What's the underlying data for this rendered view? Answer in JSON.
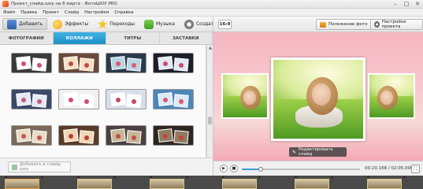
{
  "window": {
    "title": "Проект_слайд-шоу на 8 марта - ФотоШОУ PRO",
    "controls": [
      "–",
      "□",
      "✕"
    ]
  },
  "menu": [
    "Файл",
    "Правка",
    "Проект",
    "Слайд",
    "Настройки",
    "Справка"
  ],
  "toolbar": {
    "add_label": "Добавить",
    "effects_label": "Эффекты",
    "transitions_label": "Переходы",
    "music_label": "Музыка",
    "create_label": "Создать"
  },
  "tabs": [
    "ФОТОГРАФИИ",
    "КОЛЛАЖИ",
    "ТИТРЫ",
    "ЗАСТАВКИ"
  ],
  "active_tab": "КОЛЛАЖИ",
  "collages": [
    {
      "palette": [
        "#3a3a3a",
        "#ffffff",
        "#d94c6b"
      ]
    },
    {
      "palette": [
        "#6a4a3a",
        "#f4e1c1",
        "#c34a4a"
      ]
    },
    {
      "palette": [
        "#2a3a4a",
        "#b9d4e6",
        "#e05a6d"
      ]
    },
    {
      "palette": [
        "#1b1f2a",
        "#dfe8f2",
        "#d04a6a"
      ]
    },
    {
      "palette": [
        "#3b4a6a",
        "#e6e9f2",
        "#c85a7a"
      ]
    },
    {
      "palette": [
        "#f1f1f1",
        "#ffffff",
        "#d64b6b"
      ]
    },
    {
      "palette": [
        "#d9dfe8",
        "#ffffff",
        "#c24a64"
      ]
    },
    {
      "palette": [
        "#4d86b9",
        "#dbe9f5",
        "#d75a70"
      ]
    },
    {
      "palette": [
        "#7a6a5a",
        "#e8dcc4",
        "#c6545e"
      ]
    },
    {
      "palette": [
        "#5a3a2a",
        "#f0d7b2",
        "#b3403a"
      ]
    },
    {
      "palette": [
        "#4a4240",
        "#c7b798",
        "#c0504d"
      ]
    },
    {
      "palette": [
        "#2e2622",
        "#8f7c60",
        "#c2463e"
      ]
    }
  ],
  "add_to_slide": "Добавить в слайд-шоу",
  "preview_toolbar": {
    "aspect": "16:9",
    "photo_position": "Положение фото",
    "project_settings": "Настройки проекта"
  },
  "edit_slide": "Редактировать слайд",
  "player": {
    "timecode": "00:20.168 / 02:05.000",
    "progress": 0.16
  },
  "colors": {
    "accent_tab": "#2a9fd6",
    "preview_bg": "#f6b7c2"
  }
}
